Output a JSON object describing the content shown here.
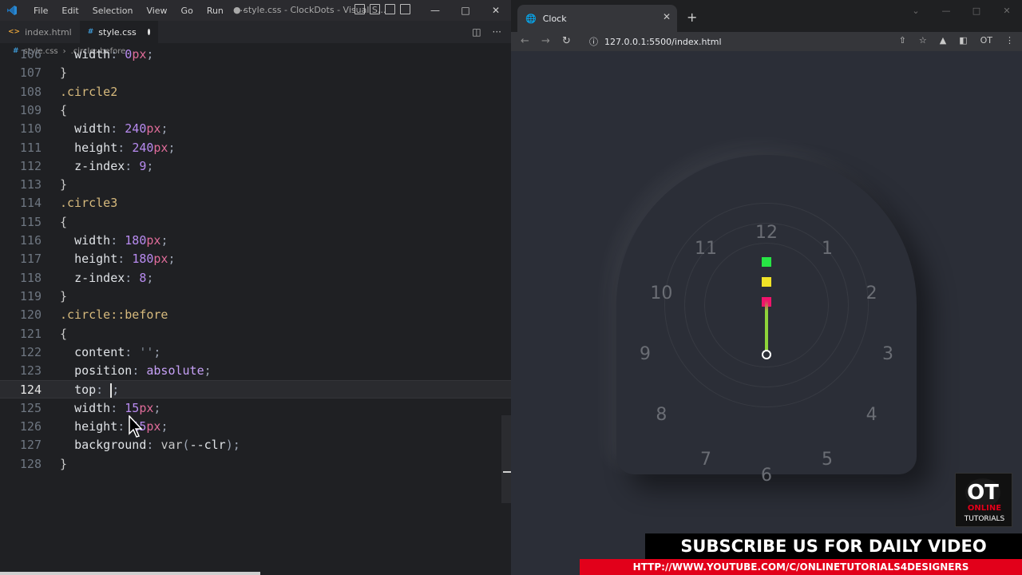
{
  "vscode": {
    "menu": [
      "File",
      "Edit",
      "Selection",
      "View",
      "Go",
      "Run",
      "···"
    ],
    "window_title": "● style.css - ClockDots - Visual S...",
    "tabs": [
      {
        "label": "index.html",
        "icon": "html-file-icon"
      },
      {
        "label": "style.css",
        "icon": "css-file-icon",
        "modified": true
      }
    ],
    "breadcrumb": [
      "style.css",
      ".circle::before"
    ],
    "lines": [
      {
        "n": "106",
        "code": "  width: 0px;"
      },
      {
        "n": "107",
        "code": "}"
      },
      {
        "n": "108",
        "code": ".circle2"
      },
      {
        "n": "109",
        "code": "{"
      },
      {
        "n": "110",
        "code": "  width: 240px;"
      },
      {
        "n": "111",
        "code": "  height: 240px;"
      },
      {
        "n": "112",
        "code": "  z-index: 9;"
      },
      {
        "n": "113",
        "code": "}"
      },
      {
        "n": "114",
        "code": ".circle3"
      },
      {
        "n": "115",
        "code": "{"
      },
      {
        "n": "116",
        "code": "  width: 180px;"
      },
      {
        "n": "117",
        "code": "  height: 180px;"
      },
      {
        "n": "118",
        "code": "  z-index: 8;"
      },
      {
        "n": "119",
        "code": "}"
      },
      {
        "n": "120",
        "code": ".circle::before"
      },
      {
        "n": "121",
        "code": "{"
      },
      {
        "n": "122",
        "code": "  content: '';"
      },
      {
        "n": "123",
        "code": "  position: absolute;"
      },
      {
        "n": "124",
        "code": "  top: ;"
      },
      {
        "n": "125",
        "code": "  width: 15px;"
      },
      {
        "n": "126",
        "code": "  height: 15px;"
      },
      {
        "n": "127",
        "code": "  background: var(--clr);"
      },
      {
        "n": "128",
        "code": "}"
      }
    ],
    "current_line": "124"
  },
  "chrome": {
    "tab_title": "Clock",
    "url": "127.0.0.1:5500/index.html"
  },
  "clock": {
    "numbers": [
      "12",
      "1",
      "2",
      "3",
      "4",
      "5",
      "6",
      "7",
      "8",
      "9",
      "10",
      "11"
    ],
    "dots": [
      {
        "name": "green-dot",
        "color": "#27e545"
      },
      {
        "name": "yellow-dot",
        "color": "#f0e327"
      },
      {
        "name": "pink-dot",
        "color": "#f0146b"
      }
    ]
  },
  "branding": {
    "logo_text": "OT",
    "logo_sub1": "ONLINE",
    "logo_sub2": "TUTORIALS",
    "subscribe": "SUBSCRIBE US FOR DAILY VIDEO",
    "youtube_url": "HTTP://WWW.YOUTUBE.COM/C/ONLINETUTORIALS4DESIGNERS"
  }
}
